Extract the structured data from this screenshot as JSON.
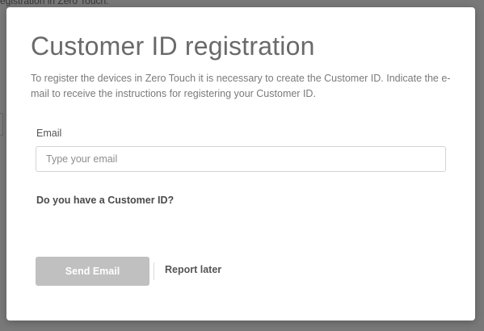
{
  "background": {
    "partial_text": "egistration in Zero Touch."
  },
  "modal": {
    "title": "Customer ID registration",
    "description": "To register the devices in Zero Touch it is necessary to create the Customer ID. Indicate the e-mail to receive the instructions for registering your Customer ID.",
    "email_label": "Email",
    "email_placeholder": "Type your email",
    "email_value": "",
    "customer_id_question": "Do you have a Customer ID?",
    "send_button_label": "Send Email",
    "report_later_label": "Report later"
  },
  "colors": {
    "overlay": "#7a7a7a",
    "disabled_button": "#c0c0c0",
    "title_text": "#6a6a6a"
  }
}
